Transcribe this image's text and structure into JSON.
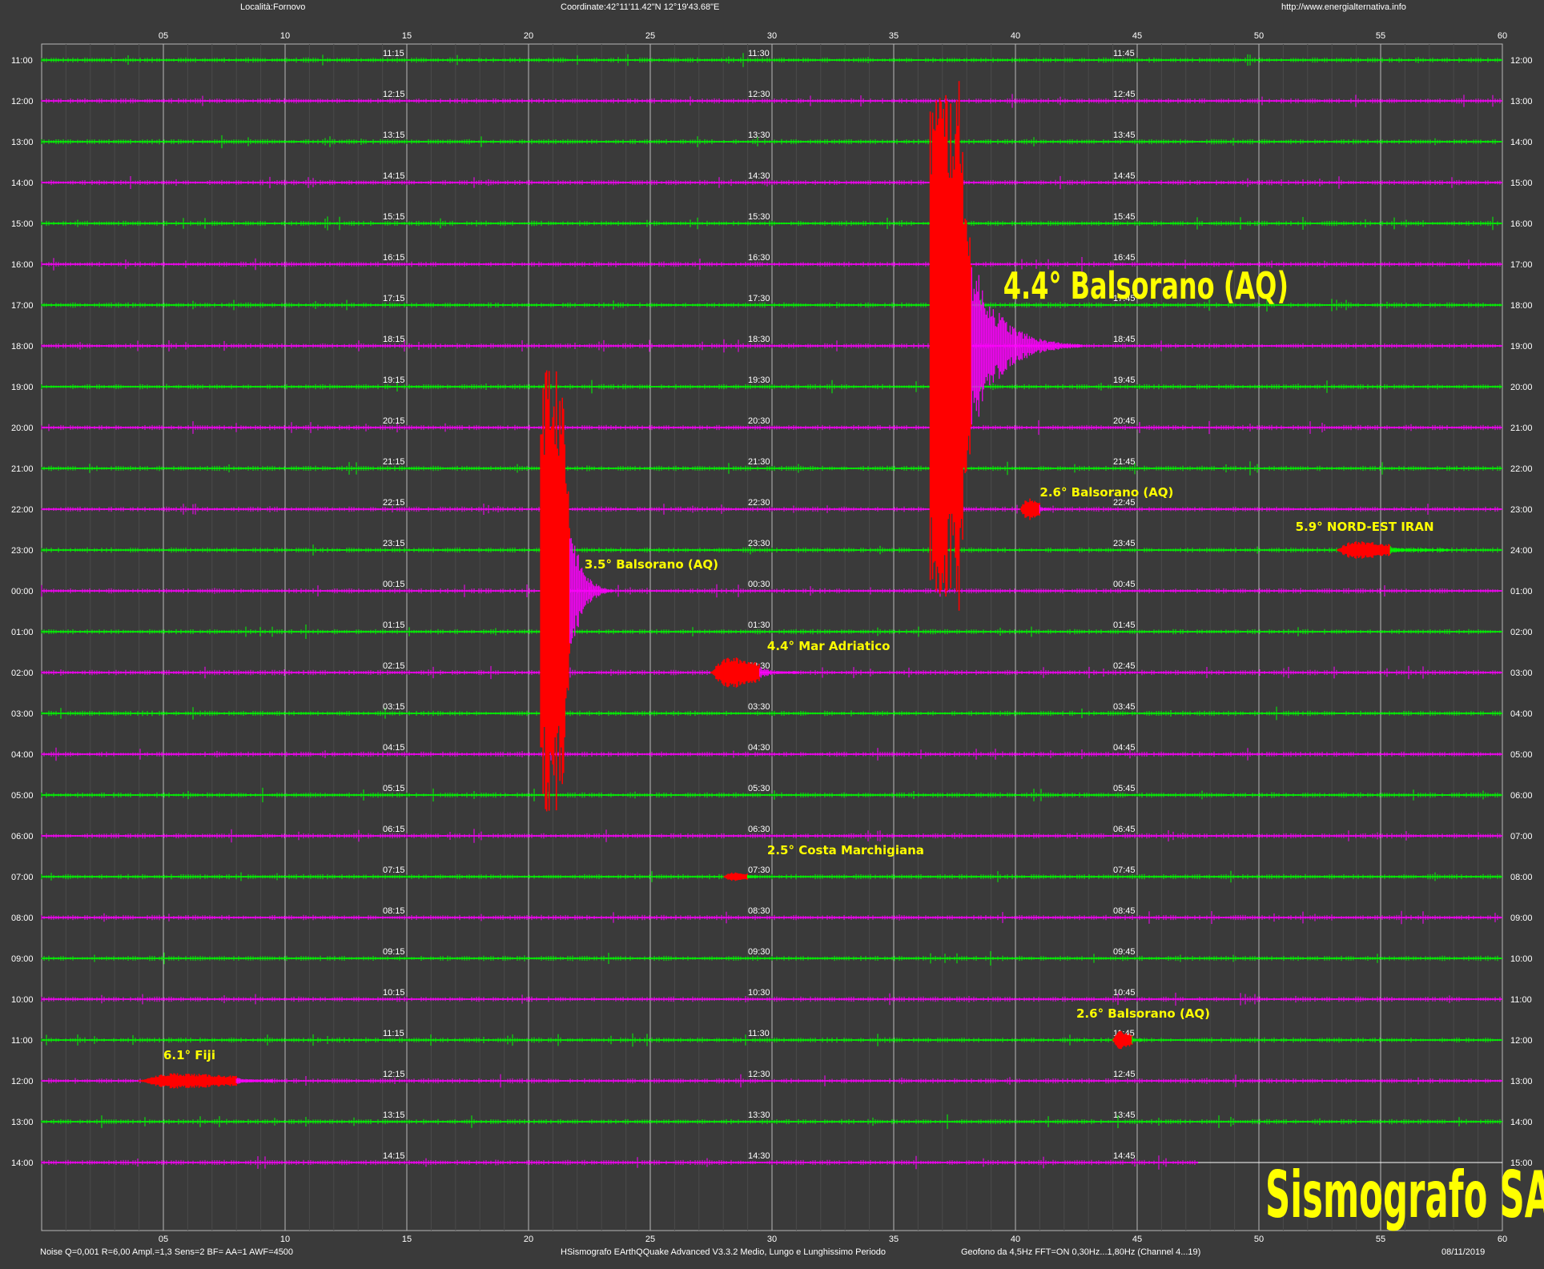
{
  "header": {
    "location": "Località:Fornovo",
    "coordinates": "Coordinate:42°11'11.42\"N  12°19'43.68\"E",
    "url": "http://www.energialternativa.info"
  },
  "footer": {
    "settings": "Noise Q=0,001 R=6,00 Ampl.=1,3 Sens=2 BF= AA=1 AWF=4500",
    "software": "HSismografo  EArthQQuake Advanced V3.3.2  Medio, Lungo e Lunghissimo Periodo",
    "sensor": "Geofono da 4,5Hz FFT=ON 0,30Hz...1,80Hz      (Channel 4...19)",
    "date": "08/11/2019"
  },
  "watermark": "Sismografo SABINA",
  "colors": {
    "background": "#3a3a3a",
    "trace_a": "#00ff00",
    "trace_b": "#ff00ff",
    "event": "#ff0000",
    "label": "#ffff00",
    "grid": "#b8b8b8"
  },
  "chart_data": {
    "type": "line",
    "title": "",
    "xlim": [
      0,
      60
    ],
    "x_ticks": [
      "05",
      "10",
      "15",
      "20",
      "25",
      "30",
      "35",
      "40",
      "45",
      "50",
      "55",
      "60"
    ],
    "left_labels": [
      "11:00",
      "12:00",
      "13:00",
      "14:00",
      "15:00",
      "16:00",
      "17:00",
      "18:00",
      "19:00",
      "20:00",
      "21:00",
      "22:00",
      "23:00",
      "00:00",
      "01:00",
      "02:00",
      "03:00",
      "04:00",
      "05:00",
      "06:00",
      "07:00",
      "08:00",
      "09:00",
      "10:00",
      "11:00",
      "12:00",
      "13:00",
      "14:00"
    ],
    "right_labels": [
      "12:00",
      "13:00",
      "14:00",
      "15:00",
      "16:00",
      "17:00",
      "18:00",
      "19:00",
      "20:00",
      "21:00",
      "22:00",
      "23:00",
      "24:00",
      "01:00",
      "02:00",
      "03:00",
      "04:00",
      "05:00",
      "06:00",
      "07:00",
      "08:00",
      "09:00",
      "10:00",
      "11:00",
      "12:00",
      "13:00",
      "14:00",
      "15:00"
    ],
    "mid_labels": [
      [
        "11:15",
        "11:30",
        "11:45"
      ],
      [
        "12:15",
        "12:30",
        "12:45"
      ],
      [
        "13:15",
        "13:30",
        "13:45"
      ],
      [
        "14:15",
        "14:30",
        "14:45"
      ],
      [
        "15:15",
        "15:30",
        "15:45"
      ],
      [
        "16:15",
        "16:30",
        "16:45"
      ],
      [
        "17:15",
        "17:30",
        "17:45"
      ],
      [
        "18:15",
        "18:30",
        "18:45"
      ],
      [
        "19:15",
        "19:30",
        "19:45"
      ],
      [
        "20:15",
        "20:30",
        "20:45"
      ],
      [
        "21:15",
        "21:30",
        "21:45"
      ],
      [
        "22:15",
        "22:30",
        "22:45"
      ],
      [
        "23:15",
        "23:30",
        "23:45"
      ],
      [
        "00:15",
        "00:30",
        "00:45"
      ],
      [
        "01:15",
        "01:30",
        "01:45"
      ],
      [
        "02:15",
        "02:30",
        "02:45"
      ],
      [
        "03:15",
        "03:30",
        "03:45"
      ],
      [
        "04:15",
        "04:30",
        "04:45"
      ],
      [
        "05:15",
        "05:30",
        "05:45"
      ],
      [
        "06:15",
        "06:30",
        "06:45"
      ],
      [
        "07:15",
        "07:30",
        "07:45"
      ],
      [
        "08:15",
        "08:30",
        "08:45"
      ],
      [
        "09:15",
        "09:30",
        "09:45"
      ],
      [
        "10:15",
        "10:30",
        "10:45"
      ],
      [
        "11:15",
        "11:30",
        "11:45"
      ],
      [
        "12:15",
        "12:30",
        "12:45"
      ],
      [
        "13:15",
        "13:30",
        "13:45"
      ],
      [
        "14:15",
        "14:30",
        "14:45"
      ]
    ],
    "trace_end_minute_last_row": 47.5,
    "events": [
      {
        "label": "4.4° Balsorano (AQ)",
        "row": 7,
        "minute": 36.5,
        "amplitude_rows": 6.5,
        "duration": 1.7,
        "coda": 4.5
      },
      {
        "label": "3.5° Balsorano (AQ)",
        "row": 13,
        "minute": 20.5,
        "amplitude_rows": 5.5,
        "duration": 1.2,
        "coda": 1.8
      },
      {
        "label": "4.4° Mar Adriatico",
        "row": 15,
        "minute": 27.5,
        "amplitude_rows": 0.5,
        "duration": 2.0,
        "coda": 1.6
      },
      {
        "label": "2.6° Balsorano (AQ)",
        "row": 11,
        "minute": 40.2,
        "amplitude_rows": 0.35,
        "duration": 0.8,
        "coda": 0.4
      },
      {
        "label": "5.9° NORD-EST IRAN",
        "row": 12,
        "minute": 53.2,
        "amplitude_rows": 0.3,
        "duration": 2.2,
        "coda": 2.4
      },
      {
        "label": "2.5° Costa Marchigiana",
        "row": 20,
        "minute": 28.0,
        "amplitude_rows": 0.15,
        "duration": 1.0,
        "coda": 0.4
      },
      {
        "label": "2.6° Balsorano (AQ)",
        "row": 24,
        "minute": 44.0,
        "amplitude_rows": 0.3,
        "duration": 0.8,
        "coda": 0.4
      },
      {
        "label": "6.1° Fiji",
        "row": 25,
        "minute": 4.0,
        "amplitude_rows": 0.25,
        "duration": 4.0,
        "coda": 1.5
      }
    ]
  }
}
